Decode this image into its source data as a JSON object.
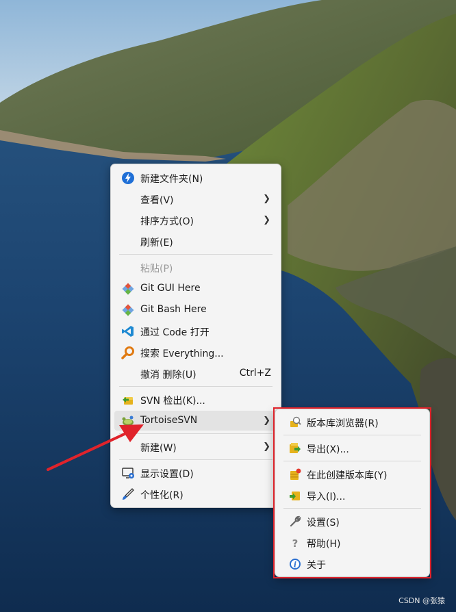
{
  "main_menu": {
    "items": [
      {
        "label": "新建文件夹(N)",
        "icon": "new-folder-icon"
      },
      {
        "label": "查看(V)",
        "icon": ""
      },
      {
        "label": "排序方式(O)",
        "icon": ""
      },
      {
        "label": "刷新(E)",
        "icon": ""
      },
      {
        "label": "粘贴(P)",
        "icon": ""
      },
      {
        "label": "Git GUI Here",
        "icon": "git-icon"
      },
      {
        "label": "Git Bash Here",
        "icon": "git-icon"
      },
      {
        "label": "通过 Code 打开",
        "icon": "vscode-icon"
      },
      {
        "label": "搜索 Everything...",
        "icon": "everything-icon"
      },
      {
        "label": "撤消 删除(U)",
        "icon": "",
        "shortcut": "Ctrl+Z"
      },
      {
        "label": "SVN 检出(K)...",
        "icon": "svn-checkout-icon"
      },
      {
        "label": "TortoiseSVN",
        "icon": "tortoisesvn-icon"
      },
      {
        "label": "新建(W)",
        "icon": ""
      },
      {
        "label": "显示设置(D)",
        "icon": "display-settings-icon"
      },
      {
        "label": "个性化(R)",
        "icon": "personalize-brush-icon"
      }
    ]
  },
  "sub_menu": {
    "items": [
      {
        "label": "版本库浏览器(R)",
        "icon": "repo-browser-icon"
      },
      {
        "label": "导出(X)...",
        "icon": "export-icon"
      },
      {
        "label": "在此创建版本库(Y)",
        "icon": "create-repo-icon"
      },
      {
        "label": "导入(I)...",
        "icon": "import-icon"
      },
      {
        "label": "设置(S)",
        "icon": "wrench-icon"
      },
      {
        "label": "帮助(H)",
        "icon": "help-icon"
      },
      {
        "label": "关于",
        "icon": "info-icon"
      }
    ]
  },
  "watermark": "CSDN @张猿",
  "colors": {
    "highlight_box": "#e0232b",
    "arrow": "#e0232b",
    "menu_bg": "#f4f4f4"
  }
}
